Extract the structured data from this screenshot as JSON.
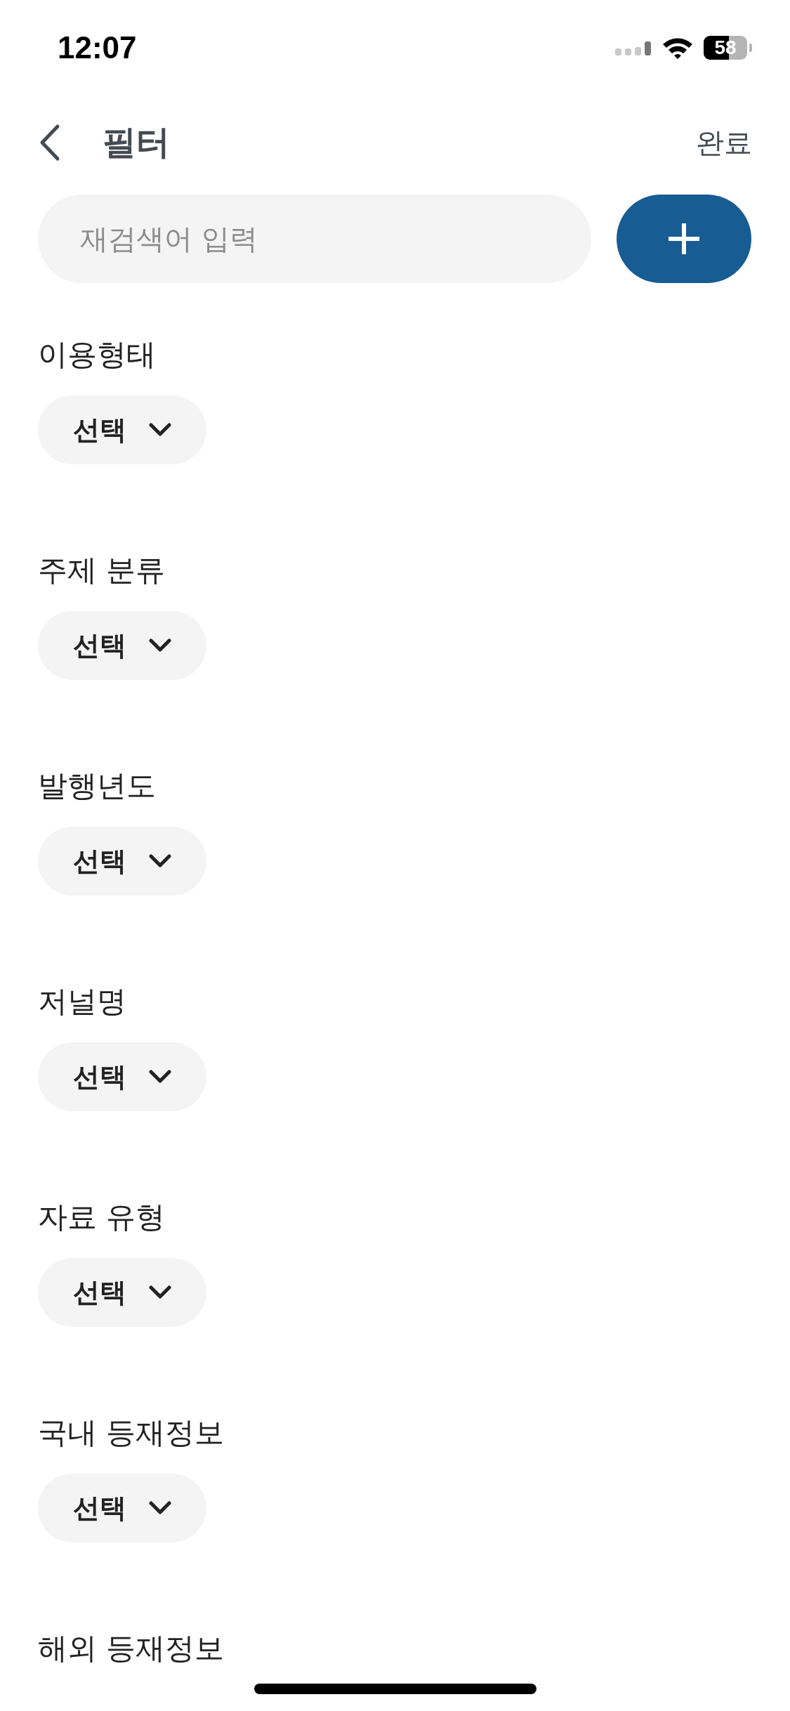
{
  "status_bar": {
    "time": "12:07",
    "battery": "58"
  },
  "header": {
    "title": "필터",
    "action": "완료"
  },
  "search": {
    "placeholder": "재검색어 입력"
  },
  "filters": [
    {
      "label": "이용형태",
      "dropdown": "선택"
    },
    {
      "label": "주제 분류",
      "dropdown": "선택"
    },
    {
      "label": "발행년도",
      "dropdown": "선택"
    },
    {
      "label": "저널명",
      "dropdown": "선택"
    },
    {
      "label": "자료 유형",
      "dropdown": "선택"
    },
    {
      "label": "국내 등재정보",
      "dropdown": "선택"
    },
    {
      "label": "해외 등재정보"
    }
  ]
}
